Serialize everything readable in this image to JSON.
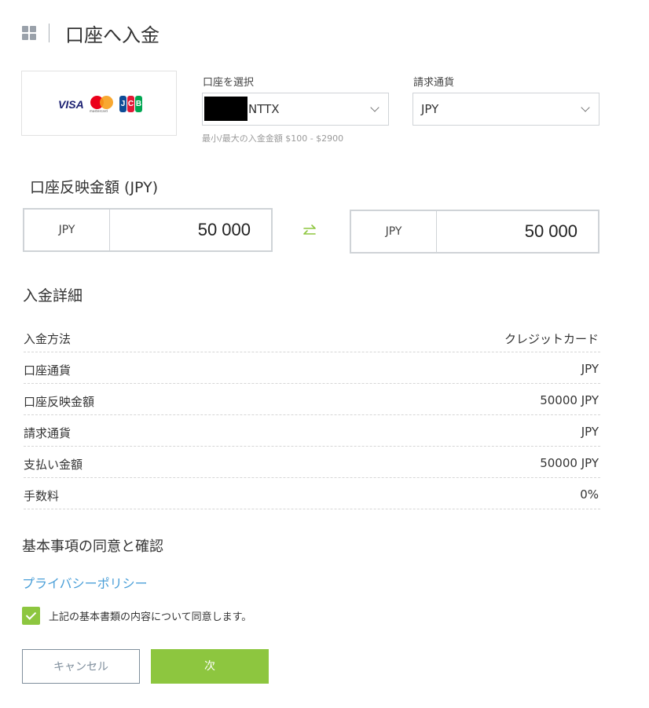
{
  "header": {
    "title": "口座へ入金"
  },
  "payment_logos": {
    "visa": "VISA",
    "mastercard": "mastercard",
    "jcb": [
      "J",
      "C",
      "B"
    ]
  },
  "account_select": {
    "label": "口座を選択",
    "value": "NTTX",
    "hint": "最小/最大の入金金額 $100 - $2900"
  },
  "currency_select": {
    "label": "請求通貨",
    "value": "JPY"
  },
  "reflected_amount": {
    "title": "口座反映金額 (JPY)",
    "left": {
      "currency": "JPY",
      "amount": "50 000"
    },
    "right": {
      "currency": "JPY",
      "amount": "50 000"
    }
  },
  "details": {
    "title": "入金詳細",
    "rows": [
      {
        "label": "入金方法",
        "value": "クレジットカード"
      },
      {
        "label": "口座通貨",
        "value": "JPY"
      },
      {
        "label": "口座反映金額",
        "value": "50000 JPY"
      },
      {
        "label": "請求通貨",
        "value": "JPY"
      },
      {
        "label": "支払い金額",
        "value": "50000 JPY"
      },
      {
        "label": "手数料",
        "value": "0%"
      }
    ]
  },
  "agreement": {
    "title": "基本事項の同意と確認",
    "privacy_link": "プライバシーポリシー",
    "checkbox_label": "上記の基本書類の内容について同意します。",
    "checked": true
  },
  "buttons": {
    "cancel": "キャンセル",
    "next": "次"
  },
  "colors": {
    "accent_green": "#8dc63f",
    "link_blue": "#4a9fd8",
    "border_gray": "#cfd3d7"
  }
}
